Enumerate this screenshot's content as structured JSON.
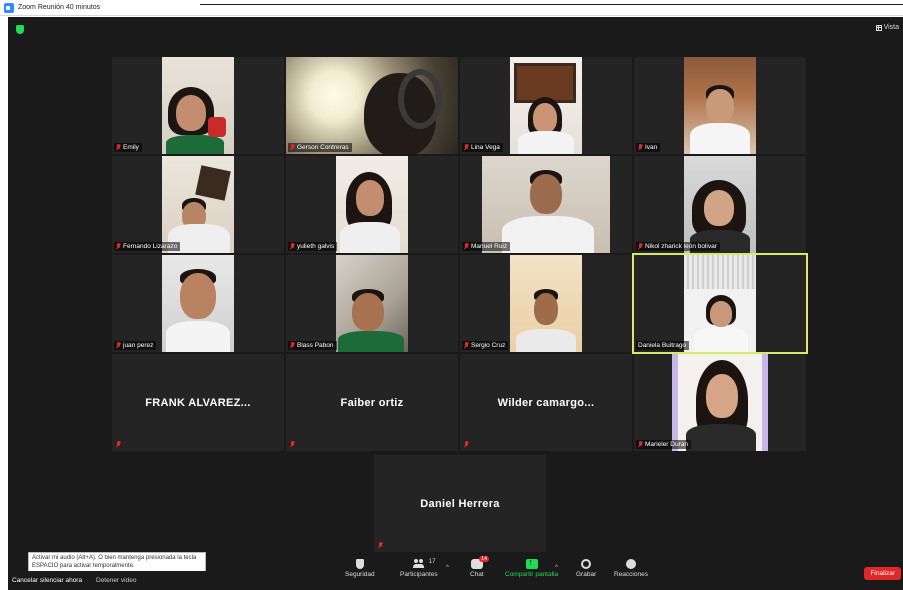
{
  "window": {
    "title": "Zoom Reunión 40 minutos"
  },
  "top_right": {
    "view_label": "Vista"
  },
  "participants": [
    {
      "name": "Emily"
    },
    {
      "name": "Gerson Contreras"
    },
    {
      "name": "Lina Vega"
    },
    {
      "name": "Ivan"
    },
    {
      "name": "Fernando Lizarazo"
    },
    {
      "name": "yulieth galvis"
    },
    {
      "name": "Manuel Ruiz"
    },
    {
      "name": "Nikol zharick león bolivar"
    },
    {
      "name": "juan perez"
    },
    {
      "name": "Blass Pabon"
    },
    {
      "name": "Sergio Cruz"
    },
    {
      "name": "Daniela Buitrago",
      "active_speaker": true
    },
    {
      "name": "FRANK ALVAREZ...",
      "video_off": true
    },
    {
      "name": "Faiber ortiz",
      "video_off": true
    },
    {
      "name": "Wilder camargo...",
      "video_off": true
    },
    {
      "name": "Marieler Duran"
    },
    {
      "name": "Daniel Herrera",
      "video_off": true
    }
  ],
  "tooltip": {
    "text": "Activar mi audio (Alt+A). O bien mantenga presionada la tecla ESPACIO para activar temporalmente."
  },
  "toolbar": {
    "unmute_label": "Cancelar silenciar ahora",
    "video_label": "Detener video",
    "security_label": "Seguridad",
    "participants_label": "Participantes",
    "participants_count": "17",
    "chat_label": "Chat",
    "chat_badge": "14",
    "share_label": "Compartir pantalla",
    "record_label": "Grabar",
    "reactions_label": "Reacciones",
    "end_label": "Finalizar"
  },
  "colors": {
    "active_speaker": "#d8e86a",
    "end_button": "#e02828",
    "share": "#23d959",
    "meeting_bg": "#1a1a1a"
  }
}
